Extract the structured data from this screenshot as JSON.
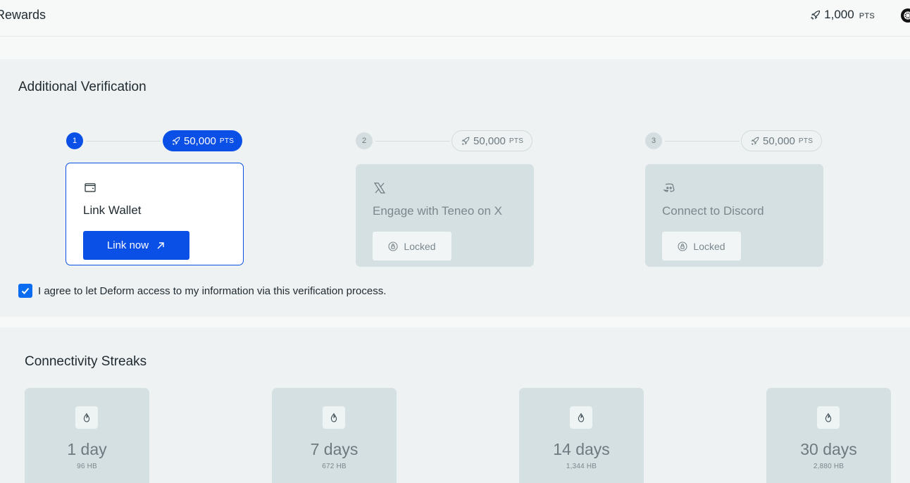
{
  "header": {
    "title": "Rewards",
    "points_value": "1,000",
    "points_unit": "PTS"
  },
  "verification": {
    "title": "Additional Verification",
    "steps": [
      {
        "number": "1",
        "points_value": "50,000",
        "points_unit": "PTS",
        "icon": "wallet-icon",
        "title": "Link Wallet",
        "button_label": "Link now",
        "state": "active"
      },
      {
        "number": "2",
        "points_value": "50,000",
        "points_unit": "PTS",
        "icon": "x-logo-icon",
        "title": "Engage with Teneo on X",
        "button_label": "Locked",
        "state": "locked"
      },
      {
        "number": "3",
        "points_value": "50,000",
        "points_unit": "PTS",
        "icon": "discord-icon",
        "title": "Connect to Discord",
        "button_label": "Locked",
        "state": "locked"
      }
    ],
    "agree_checked": true,
    "agree_text": "I agree to let Deform access to my information via this verification process."
  },
  "streaks": {
    "title": "Connectivity Streaks",
    "items": [
      {
        "days": "1 day",
        "hb": "96 HB"
      },
      {
        "days": "7 days",
        "hb": "672 HB"
      },
      {
        "days": "14 days",
        "hb": "1,344 HB"
      },
      {
        "days": "30 days",
        "hb": "2,880 HB"
      }
    ]
  },
  "colors": {
    "accent": "#0a4fe6",
    "panel_bg": "#eef2f3",
    "locked_card_bg": "#d5e0e3"
  }
}
